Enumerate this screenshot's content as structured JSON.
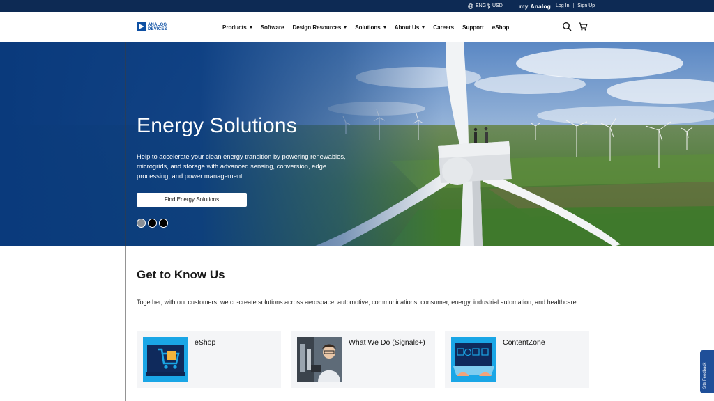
{
  "topbar": {
    "language": "ENG",
    "currency": "USD",
    "brand_my": "my",
    "brand_analog": "Analog",
    "login": "Log In",
    "divider": "|",
    "signup": "Sign Up"
  },
  "logo": {
    "line1": "ANALOG",
    "line2": "DEVICES"
  },
  "nav": [
    {
      "label": "Products",
      "dropdown": true
    },
    {
      "label": "Software",
      "dropdown": false
    },
    {
      "label": "Design Resources",
      "dropdown": true
    },
    {
      "label": "Solutions",
      "dropdown": true
    },
    {
      "label": "About Us",
      "dropdown": true
    },
    {
      "label": "Careers",
      "dropdown": false
    },
    {
      "label": "Support",
      "dropdown": false
    },
    {
      "label": "eShop",
      "dropdown": false
    }
  ],
  "header_icons": [
    "search-icon",
    "cart-icon"
  ],
  "hero": {
    "title": "Energy Solutions",
    "description": "Help to accelerate your clean energy transition by powering renewables, microgrids, and storage with advanced sensing, conversion, edge processing, and power management.",
    "button": "Find Energy Solutions",
    "carousel_total": 3,
    "carousel_active": 1
  },
  "section": {
    "title": "Get to Know Us",
    "description": "Together, with our customers, we co-create solutions across aerospace, automotive, communications, consumer, energy, industrial automation, and healthcare."
  },
  "cards": [
    {
      "label": "eShop",
      "icon": "eshop-cart-illustration"
    },
    {
      "label": "What We Do (Signals+)",
      "icon": "scientist-photo"
    },
    {
      "label": "ContentZone",
      "icon": "laptop-media-illustration"
    }
  ],
  "feedback": {
    "label": "Site Feedback"
  },
  "colors": {
    "topbar_bg": "#0d2a54",
    "brand_blue": "#0d4fa3",
    "hero_overlay": "#0b3b7a",
    "card_bg": "#f4f5f7",
    "feedback_bg": "#1f4f99"
  }
}
